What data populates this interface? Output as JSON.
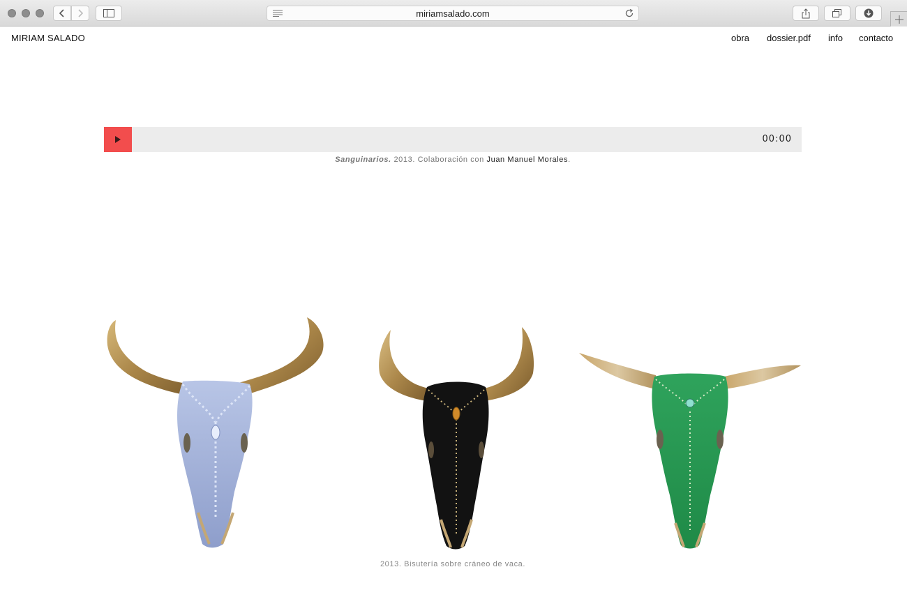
{
  "browser": {
    "url": "miriamsalado.com"
  },
  "site": {
    "title": "MIRIAM SALADO",
    "nav": [
      "obra",
      "dossier.pdf",
      "info",
      "contacto"
    ]
  },
  "player": {
    "time": "00:00",
    "progress": 0
  },
  "audio_caption": {
    "title": "Sanguinarios.",
    "text": " 2013. Colaboración con ",
    "link": "Juan Manuel Morales",
    "end": "."
  },
  "gallery": {
    "images": [
      "blue-crystal-bull-skull",
      "black-beaded-bull-skull",
      "green-beaded-bull-skull"
    ],
    "caption": "2013. Bisutería sobre cráneo de vaca."
  },
  "colors": {
    "play_button": "#f24d4d",
    "player_track": "#ececec",
    "horn_gold": "#b8955a",
    "skull_blue": "#a9b7da",
    "skull_black": "#111111",
    "skull_green": "#2a9a55"
  }
}
